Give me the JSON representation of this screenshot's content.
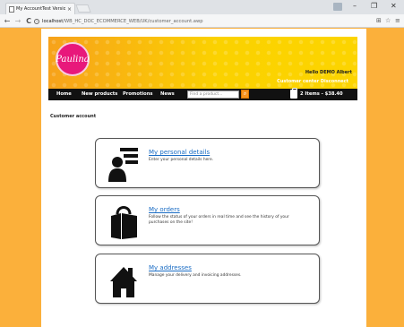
{
  "browser": {
    "tab_title": "My AccountTest Versio",
    "tab_close": "×",
    "window_controls": {
      "minimize": "–",
      "restore": "❐",
      "close": "✕"
    },
    "nav": {
      "back": "←",
      "forward": "→",
      "reload": "C"
    },
    "address": {
      "host": "localhost",
      "path": "/WB_HC_DOC_ECOMMERCE_WEB/UK/customer_account.awp"
    },
    "toolbar_icons": [
      "translate-icon",
      "star-icon",
      "menu-icon"
    ]
  },
  "header": {
    "logo_text": "Paulina",
    "greeting": "Hello DEMO Albert",
    "customer_centre": "Customer center Disconnect"
  },
  "navbar": {
    "items": [
      "Home",
      "New products",
      "Promotions",
      "News"
    ],
    "search_placeholder": "Find a product...",
    "cart_label": "2 Items - $38.40"
  },
  "page_title": "Customer account",
  "cards": [
    {
      "title": "My personal details",
      "description": "Enter your personal details here.",
      "icon": "person-details-icon"
    },
    {
      "title": "My orders",
      "description": "Follow the status of your orders in real time and see the history of your purchases on the site!",
      "icon": "shopping-bag-icon"
    },
    {
      "title": "My addresses",
      "description": "Manage your delivery and invoicing addresses.",
      "icon": "house-icon"
    }
  ],
  "colors": {
    "background": "#fbb03b",
    "link": "#1a6cc4",
    "navbar": "#111111",
    "logo": "#e8187b"
  }
}
